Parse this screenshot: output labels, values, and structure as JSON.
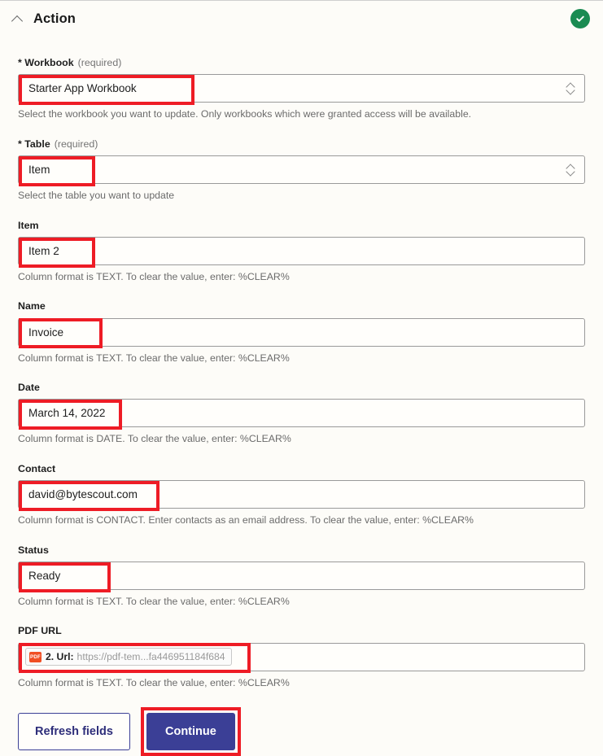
{
  "header": {
    "title": "Action",
    "collapse_icon": "chevron-up-icon",
    "status_icon": "check-circle-icon",
    "status_color": "#1a8b52"
  },
  "theme": {
    "page_background": "#fdfcf8",
    "annotation_color": "#ee1c25",
    "primary_button_color": "#3b3f96",
    "input_border": "#9a9a9a",
    "helper_text": "#6b6b6b"
  },
  "fields": [
    {
      "label": "* Workbook",
      "required_note": "(required)",
      "type": "select",
      "value": "Starter App Workbook",
      "helper": "Select the workbook you want to update. Only workbooks which were granted access will be available."
    },
    {
      "label": "* Table",
      "required_note": "(required)",
      "type": "select",
      "value": "Item",
      "helper": "Select the table you want to update"
    },
    {
      "label": "Item",
      "required_note": "",
      "type": "text",
      "value": "Item 2",
      "helper": "Column format is TEXT. To clear the value, enter: %CLEAR%"
    },
    {
      "label": "Name",
      "required_note": "",
      "type": "text",
      "value": "Invoice",
      "helper": "Column format is TEXT. To clear the value, enter: %CLEAR%"
    },
    {
      "label": "Date",
      "required_note": "",
      "type": "text",
      "value": "March 14, 2022",
      "helper": "Column format is DATE. To clear the value, enter: %CLEAR%"
    },
    {
      "label": "Contact",
      "required_note": "",
      "type": "text",
      "value": "david@bytescout.com",
      "helper": "Column format is CONTACT. Enter contacts as an email address. To clear the value, enter: %CLEAR%"
    },
    {
      "label": "Status",
      "required_note": "",
      "type": "text",
      "value": "Ready",
      "helper": "Column format is TEXT. To clear the value, enter: %CLEAR%"
    },
    {
      "label": "PDF URL",
      "required_note": "",
      "type": "token",
      "token": {
        "icon_label": "PDF",
        "icon_color": "#f04e23",
        "key": "2. Url:",
        "value": "https://pdf-tem...fa446951184f684"
      },
      "helper": "Column format is TEXT. To clear the value, enter: %CLEAR%"
    }
  ],
  "buttons": {
    "refresh_label": "Refresh fields",
    "continue_label": "Continue"
  }
}
